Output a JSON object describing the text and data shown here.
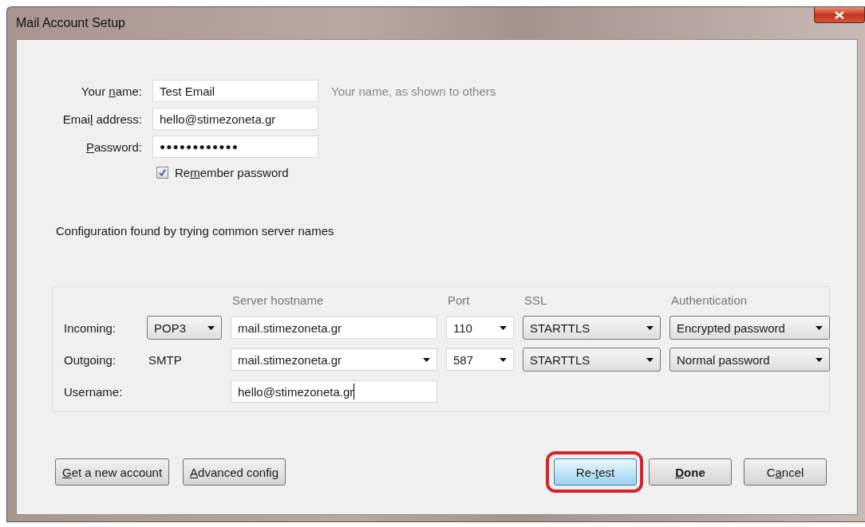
{
  "window": {
    "title": "Mail Account Setup"
  },
  "identity": {
    "fields": [
      {
        "label": {
          "before": "Your ",
          "key": "n",
          "after": "ame:"
        },
        "value": "Test Email",
        "kind": "text"
      },
      {
        "label": {
          "before": "Emai",
          "key": "l",
          "after": " address:"
        },
        "value": "hello@stimezoneta.gr",
        "kind": "text"
      },
      {
        "label": {
          "key": "P",
          "after": "assword:"
        },
        "value": "●●●●●●●●●●●●",
        "kind": "password"
      }
    ],
    "hint": "Your name, as shown to others",
    "remember": {
      "label": {
        "before": "Re",
        "key": "m",
        "after": "ember password"
      },
      "checked": true
    }
  },
  "config_message": "Configuration found by trying common server names",
  "server_settings": {
    "columns": [
      "Server hostname",
      "Port",
      "SSL",
      "Authentication"
    ],
    "rows": [
      {
        "label": "Incoming:",
        "protocol": {
          "value": "POP3",
          "kind": "select"
        },
        "hostname": {
          "value": "mail.stimezoneta.gr",
          "kind": "text"
        },
        "port": {
          "value": "110",
          "kind": "combo"
        },
        "ssl": {
          "value": "STARTTLS",
          "kind": "select"
        },
        "auth": {
          "value": "Encrypted password",
          "kind": "select"
        }
      },
      {
        "label": "Outgoing:",
        "protocol": {
          "value": "SMTP",
          "kind": "static"
        },
        "hostname": {
          "value": "mail.stimezoneta.gr",
          "kind": "combo"
        },
        "port": {
          "value": "587",
          "kind": "combo"
        },
        "ssl": {
          "value": "STARTTLS",
          "kind": "select"
        },
        "auth": {
          "value": "Normal password",
          "kind": "select"
        }
      }
    ],
    "username": {
      "label": "Username:",
      "value": "hello@stimezoneta.gr",
      "focused": true
    }
  },
  "buttons_left": [
    {
      "label": {
        "key": "G",
        "after": "et a new account"
      },
      "default": false,
      "focused": false
    },
    {
      "label": {
        "key": "A",
        "after": "dvanced config"
      },
      "default": false,
      "focused": false
    }
  ],
  "buttons_right": [
    {
      "label": {
        "before": "Re-",
        "key": "t",
        "after": "est"
      },
      "default": false,
      "focused": true,
      "highlighted": true
    },
    {
      "label": {
        "key": "D",
        "after": "one"
      },
      "default": true,
      "focused": false,
      "highlighted": false
    },
    {
      "label": {
        "before": "C",
        "key": "a",
        "after": "ncel"
      },
      "default": false,
      "focused": false,
      "highlighted": false
    }
  ]
}
